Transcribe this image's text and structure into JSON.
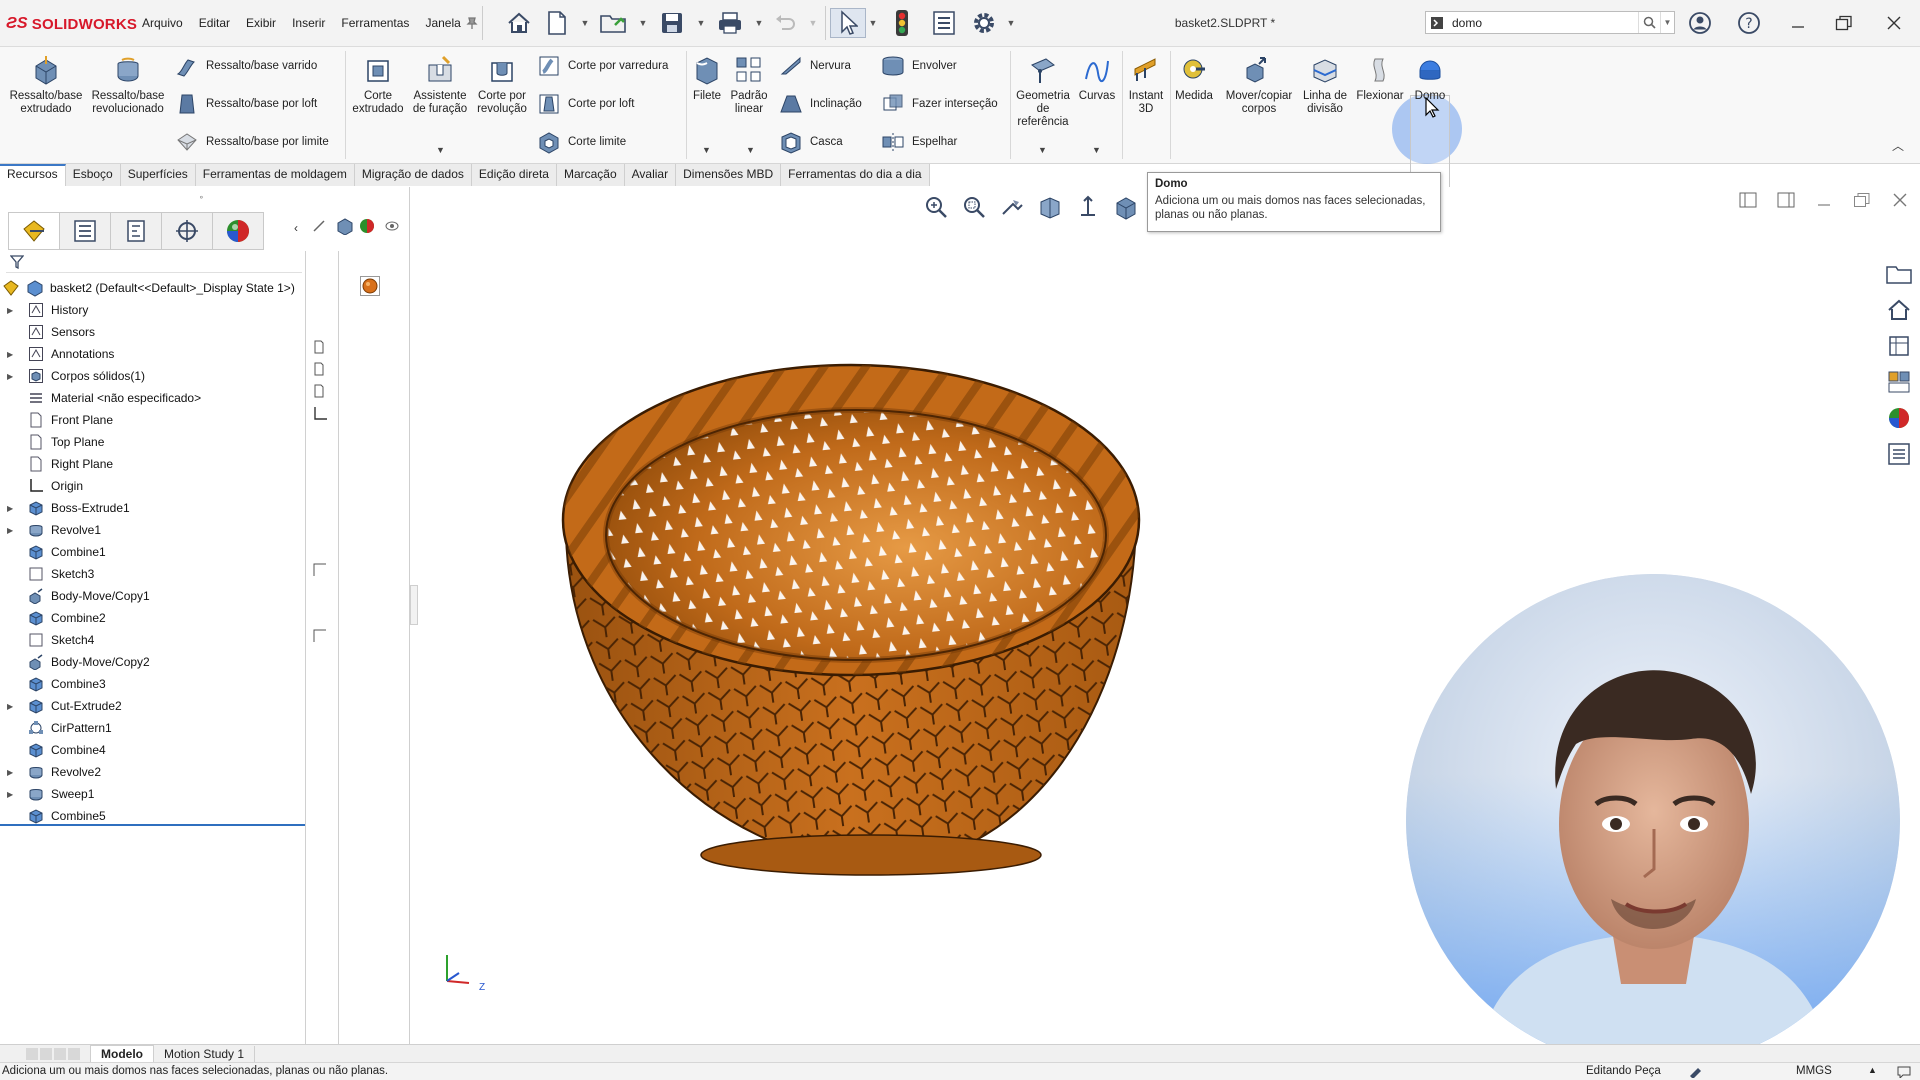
{
  "app": {
    "logo_text": "SOLIDWORKS",
    "document_title": "basket2.SLDPRT *"
  },
  "menu": [
    "Arquivo",
    "Editar",
    "Exibir",
    "Inserir",
    "Ferramentas",
    "Janela"
  ],
  "search": {
    "value": "domo"
  },
  "ribbon": {
    "extrude_boss": "Ressalto/base extrudado",
    "revolve_boss": "Ressalto/base revolucionado",
    "swept_boss": "Ressalto/base varrido",
    "loft_boss": "Ressalto/base por loft",
    "boundary_boss": "Ressalto/base por limite",
    "extrude_cut": "Corte extrudado",
    "hole_wizard": "Assistente de furação",
    "revolve_cut": "Corte por revolução",
    "swept_cut": "Corte por varredura",
    "loft_cut": "Corte por loft",
    "boundary_cut": "Corte limite",
    "fillet": "Filete",
    "linear_pattern": "Padrão linear",
    "rib": "Nervura",
    "draft": "Inclinação",
    "shell": "Casca",
    "wrap": "Envolver",
    "intersect": "Fazer interseção",
    "mirror": "Espelhar",
    "ref_geometry": "Geometria de referência",
    "curves": "Curvas",
    "instant3d": "Instant 3D",
    "measure": "Medida",
    "move_copy": "Mover/copiar corpos",
    "split_line": "Linha de divisão",
    "flex": "Flexionar",
    "dome": "Domo"
  },
  "tabs": [
    "Recursos",
    "Esboço",
    "Superfícies",
    "Ferramentas de moldagem",
    "Migração de dados",
    "Edição direta",
    "Marcação",
    "Avaliar",
    "Dimensões MBD",
    "Ferramentas do dia a dia"
  ],
  "tooltip": {
    "title": "Domo",
    "body": "Adiciona um ou mais domos nas faces selecionadas, planas ou não planas."
  },
  "tree": {
    "root": "basket2  (Default<<Default>_Display State 1>)",
    "items": [
      "History",
      "Sensors",
      "Annotations",
      "Corpos sólidos(1)",
      "Material <não especificado>",
      "Front Plane",
      "Top Plane",
      "Right Plane",
      "Origin",
      "Boss-Extrude1",
      "Revolve1",
      "Combine1",
      "Sketch3",
      "Body-Move/Copy1",
      "Combine2",
      "Sketch4",
      "Body-Move/Copy2",
      "Combine3",
      "Cut-Extrude2",
      "CirPattern1",
      "Combine4",
      "Revolve2",
      "Sweep1",
      "Combine5"
    ]
  },
  "bottom_tabs": [
    "Modelo",
    "Motion Study 1"
  ],
  "status": {
    "message": "Adiciona um ou mais domos nas faces selecionadas, planas ou não planas.",
    "mode": "Editando Peça",
    "units": "MMGS"
  },
  "triad": {
    "z_label": "Z"
  },
  "colors": {
    "model": "#c76d1c",
    "accent": "#3b78c6",
    "logo": "#d7182a"
  }
}
